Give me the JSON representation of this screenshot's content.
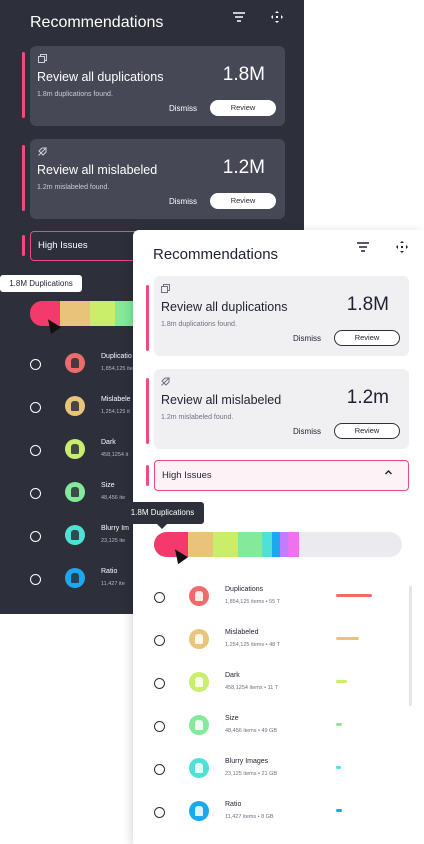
{
  "colors": {
    "accent": "#f04b7c",
    "dark_bg": "#2d2f3a",
    "dark_card": "#464856",
    "light_card": "#f0f0f3"
  },
  "segment_colors": [
    "#f43a6c",
    "#e9c37a",
    "#cbee6a",
    "#84e99a",
    "#4fe2d4",
    "#1aa9f0",
    "#c27cff",
    "#ee71ee"
  ],
  "dark": {
    "title": "Recommendations",
    "icons": {
      "filter": "filter-icon",
      "move": "move-icon"
    },
    "cards": [
      {
        "icon": "copy-icon",
        "title": "Review all duplications",
        "big": "1.8M",
        "sub": "1.8m duplications found.",
        "dismiss": "Dismiss",
        "review": "Review"
      },
      {
        "icon": "tag-off-icon",
        "title": "Review all mislabeled",
        "big": "1.2M",
        "sub": "1.2m mislabeled found.",
        "dismiss": "Dismiss",
        "review": "Review"
      }
    ],
    "issues_label": "High Issues",
    "tooltip": "1.8M Duplications",
    "rows": [
      {
        "name": "Duplicatio",
        "meta": "1,854,125 ite",
        "color": "#f06a6a"
      },
      {
        "name": "Mislabele",
        "meta": "1,254,125 it",
        "color": "#eac47a"
      },
      {
        "name": "Dark",
        "meta": "458,1254 it",
        "color": "#c8ee6c"
      },
      {
        "name": "Size",
        "meta": "48,456 ite",
        "color": "#84e99a"
      },
      {
        "name": "Blurry Im",
        "meta": "23,125 ite",
        "color": "#4fe2d4"
      },
      {
        "name": "Ratio",
        "meta": "11,427 ite",
        "color": "#1aa9f0"
      }
    ]
  },
  "light": {
    "title": "Recommendations",
    "icons": {
      "filter": "filter-icon",
      "move": "move-icon"
    },
    "cards": [
      {
        "icon": "copy-icon",
        "title": "Review all duplications",
        "big": "1.8M",
        "sub": "1.8m duplications found.",
        "dismiss": "Dismiss",
        "review": "Review"
      },
      {
        "icon": "tag-off-icon",
        "title": "Review all mislabeled",
        "big": "1.2m",
        "sub": "1.2m mislabeled found.",
        "dismiss": "Dismiss",
        "review": "Review"
      }
    ],
    "issues_label": "High Issues",
    "tooltip": "1.8M Duplications",
    "rows": [
      {
        "name": "Duplications",
        "meta": "1,854,125 items • 55 T",
        "color": "#f06a6a",
        "level": 0.95
      },
      {
        "name": "Mislabeled",
        "meta": "1,254,125 items • 48 T",
        "color": "#eac47a",
        "level": 0.6
      },
      {
        "name": "Dark",
        "meta": "458,1254 items • 11 T",
        "color": "#c8ee6c",
        "level": 0.28
      },
      {
        "name": "Size",
        "meta": "48,456 items • 49 GB",
        "color": "#84e99a",
        "level": 0.15
      },
      {
        "name": "Blurry Images",
        "meta": "23,125 items • 21 GB",
        "color": "#4fe2d4",
        "level": 0.12
      },
      {
        "name": "Ratio",
        "meta": "11,427 items • 8 GB",
        "color": "#1aa9f0",
        "level": 0.15
      }
    ]
  }
}
